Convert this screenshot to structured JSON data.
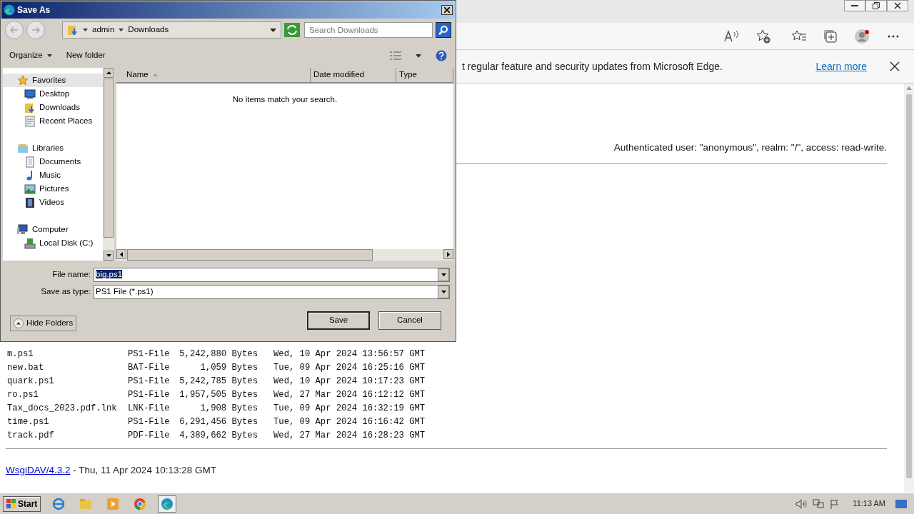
{
  "browser": {
    "infobar": {
      "message": "t regular feature and security updates from Microsoft Edge.",
      "link": "Learn more"
    },
    "auth": "Authenticated user: \"anonymous\", realm: \"/\", access: read-write.",
    "files": [
      {
        "name": "m.ps1",
        "type": "PS1-File",
        "size": "5,242,880 Bytes",
        "date": "Wed, 10 Apr 2024 13:56:57 GMT"
      },
      {
        "name": "new.bat",
        "type": "BAT-File",
        "size": "1,059 Bytes",
        "date": "Tue, 09 Apr 2024 16:25:16 GMT"
      },
      {
        "name": "quark.ps1",
        "type": "PS1-File",
        "size": "5,242,785 Bytes",
        "date": "Wed, 10 Apr 2024 10:17:23 GMT"
      },
      {
        "name": "ro.ps1",
        "type": "PS1-File",
        "size": "1,957,505 Bytes",
        "date": "Wed, 27 Mar 2024 16:12:12 GMT"
      },
      {
        "name": "Tax_docs_2023.pdf.lnk",
        "type": "LNK-File",
        "size": "1,908 Bytes",
        "date": "Tue, 09 Apr 2024 16:32:19 GMT"
      },
      {
        "name": "time.ps1",
        "type": "PS1-File",
        "size": "6,291,456 Bytes",
        "date": "Tue, 09 Apr 2024 16:16:42 GMT"
      },
      {
        "name": "track.pdf",
        "type": "PDF-File",
        "size": "4,389,662 Bytes",
        "date": "Wed, 27 Mar 2024 16:28:23 GMT"
      }
    ],
    "footer": {
      "link": "WsgiDAV/4.3.2",
      "text": "- Thu, 11 Apr 2024 10:13:28 GMT"
    }
  },
  "dialog": {
    "title": "Save As",
    "breadcrumb": [
      "admin",
      "Downloads"
    ],
    "search": {
      "placeholder": "Search Downloads"
    },
    "toolbar": [
      "Organize",
      "New folder"
    ],
    "nav": [
      {
        "label": "Favorites",
        "selected": true,
        "children": [
          {
            "label": "Desktop",
            "selected": false
          },
          {
            "label": "Downloads",
            "selected": false
          },
          {
            "label": "Recent Places",
            "selected": false
          }
        ]
      },
      {
        "label": "Libraries",
        "selected": false,
        "children": [
          {
            "label": "Documents",
            "selected": false
          },
          {
            "label": "Music",
            "selected": false
          },
          {
            "label": "Pictures",
            "selected": false
          },
          {
            "label": "Videos",
            "selected": false
          }
        ]
      },
      {
        "label": "Computer",
        "selected": false,
        "children": [
          {
            "label": "Local Disk (C:)",
            "selected": false
          }
        ]
      }
    ],
    "columns": [
      "Name",
      "Date modified",
      "Type"
    ],
    "empty_message": "No items match your search.",
    "file_name": {
      "label": "File name:",
      "value": "big.ps1"
    },
    "save_type": {
      "label": "Save as type:",
      "value": "PS1 File (*.ps1)"
    },
    "hide_folders": "Hide Folders",
    "buttons": [
      "Save",
      "Cancel"
    ]
  },
  "taskbar": {
    "start": "Start",
    "clock": "11:13 AM"
  }
}
